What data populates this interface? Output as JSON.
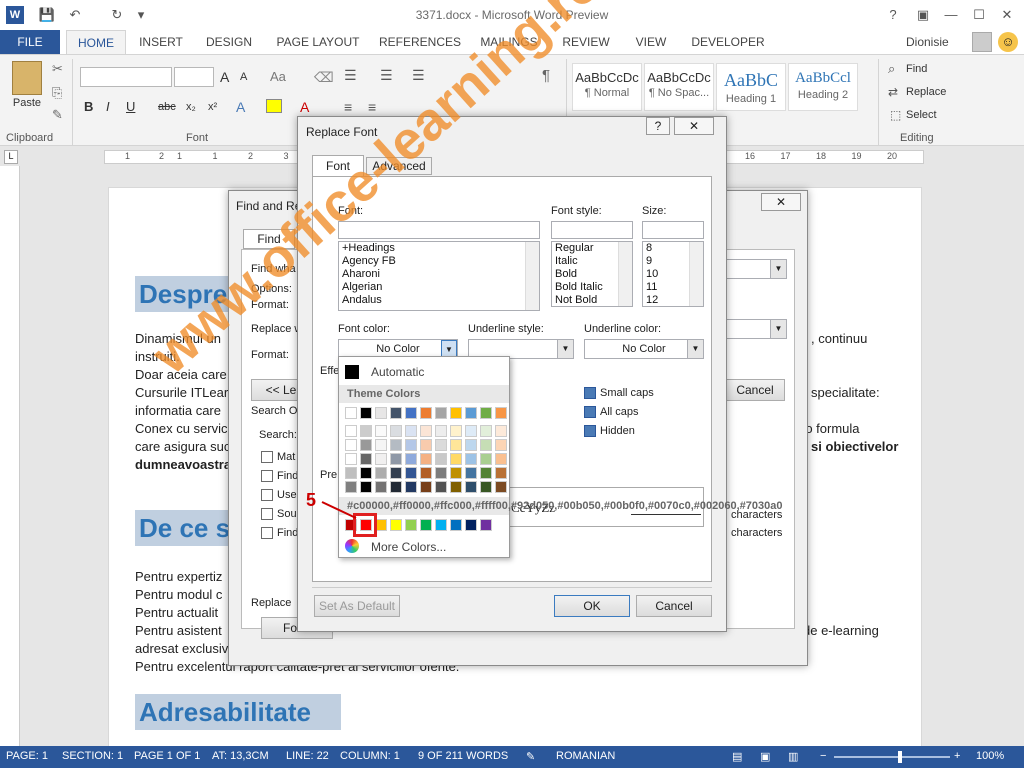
{
  "window": {
    "title": "3371.docx - Microsoft Word Preview",
    "user": "Dionisie"
  },
  "qat": {
    "app_icon": "W",
    "save": "💾",
    "undo": "↶",
    "redo": "↻",
    "more": "▾"
  },
  "winbtns": {
    "help": "?",
    "ribbon": "▣",
    "min": "—",
    "max": "☐",
    "close": "✕"
  },
  "tabs": [
    "FILE",
    "HOME",
    "INSERT",
    "DESIGN",
    "PAGE LAYOUT",
    "REFERENCES",
    "MAILINGS",
    "REVIEW",
    "VIEW",
    "DEVELOPER"
  ],
  "ribbon": {
    "clipboard": {
      "paste": "Paste",
      "label": "Clipboard"
    },
    "font": {
      "label": "Font",
      "grow": "A",
      "shrink": "A",
      "case": "Aa",
      "bold": "B",
      "italic": "I",
      "underline": "U",
      "strike": "abc",
      "sub": "x₂",
      "sup": "x²"
    },
    "paragraph": {
      "pilcrow": "¶"
    },
    "styles": [
      {
        "sample": "AaBbCcDc",
        "name": "¶ Normal"
      },
      {
        "sample": "AaBbCcDc",
        "name": "¶ No Spac..."
      },
      {
        "sample": "AaBbC",
        "name": "Heading 1"
      },
      {
        "sample": "AaBbCcl",
        "name": "Heading 2"
      }
    ],
    "editing": {
      "find": "Find",
      "replace": "Replace",
      "select": "Select",
      "label": "Editing"
    }
  },
  "ruler": {
    "marks": [
      "1",
      "2",
      "1",
      "1",
      "2",
      "3",
      "4",
      "5",
      "6",
      "7",
      "8",
      "9",
      "10",
      "11",
      "12",
      "13",
      "14",
      "15",
      "16",
      "17",
      "18",
      "19",
      "20"
    ]
  },
  "document": {
    "h1": "Despre",
    "p1a": "Dinamismul un",
    "p1b": "instruiti.",
    "p1c": "Doar aceia care",
    "p1d": "Cursurile ITLear",
    "p1e": "informatia care",
    "p1f": "Conex cu servic",
    "p1g": "care asigura suc",
    "p1h": "dumneavoastra",
    "r1": ", continuu",
    "r2": "specialitate:",
    "r3": "-o formula",
    "r4": "si obiectivelor",
    "h2": "De ce s",
    "p2a": "Pentru expertiz",
    "p2b": "Pentru modul c",
    "p2c": "Pentru actualit",
    "p2d": "Pentru asistent",
    "p2e": "adresat exclusiv",
    "p2f": "Pentru excelentul raport calitate-pret al serviciilor oferite.",
    "r5": "de e-learning",
    "h3": "Adresabilitate"
  },
  "findreplace": {
    "title": "Find and Re",
    "close": "✕",
    "tab_find": "Find",
    "find_what": "Find wha",
    "options": "Options:",
    "format1": "Format:",
    "replace_with": "Replace w",
    "format2": "Format:",
    "less": "<< Le",
    "cancel": "Cancel",
    "search_opts": "Search O",
    "search": "Search:",
    "checks": [
      "Mat",
      "Find",
      "Use",
      "Sou",
      "Find"
    ],
    "chars1": "characters",
    "chars2": "characters",
    "replace_lbl": "Replace",
    "format_btn": "Form"
  },
  "replacefont": {
    "title": "Replace Font",
    "help": "?",
    "close": "✕",
    "tab_font": "Font",
    "tab_advanced": "Advanced",
    "font_label": "Font:",
    "style_label": "Font style:",
    "size_label": "Size:",
    "fonts": [
      "+Headings",
      "Agency FB",
      "Aharoni",
      "Algerian",
      "Andalus"
    ],
    "styles": [
      "Regular",
      "Italic",
      "Bold",
      "Bold Italic",
      "Not Bold"
    ],
    "sizes": [
      "8",
      "9",
      "10",
      "11",
      "12"
    ],
    "font_color_label": "Font color:",
    "font_color_value": "No Color",
    "underline_style_label": "Underline style:",
    "underline_color_label": "Underline color:",
    "underline_color_value": "No Color",
    "effects_label": "Effe",
    "effects": [
      "Small caps",
      "All caps",
      "Hidden"
    ],
    "preview_label": "Pre",
    "preview_text": "CcYyZz",
    "set_default": "Set As Default",
    "ok": "OK",
    "cancel": "Cancel"
  },
  "colorpicker": {
    "automatic": "Automatic",
    "theme": "Theme Colors",
    "standard": [
      "#c00000",
      "#ff0000",
      "#ffc000",
      "#ffff00",
      "#92d050",
      "#00b050",
      "#00b0f0",
      "#0070c0",
      "#002060",
      "#7030a0"
    ],
    "more": "More Colors...",
    "step": "5",
    "theme_top": [
      "#ffffff",
      "#000000",
      "#e7e6e6",
      "#44546a",
      "#4472c4",
      "#ed7d31",
      "#a5a5a5",
      "#ffc000",
      "#5b9bd5",
      "#70ad47",
      "#f79646"
    ]
  },
  "watermark": "www.office-learning.ro",
  "status": {
    "page": "PAGE: 1",
    "section": "SECTION: 1",
    "pageof": "PAGE 1 OF 1",
    "at": "AT: 13,3CM",
    "line": "LINE: 22",
    "column": "COLUMN: 1",
    "words": "9 OF 211 WORDS",
    "lang": "ROMANIAN",
    "zoom": "100%"
  }
}
